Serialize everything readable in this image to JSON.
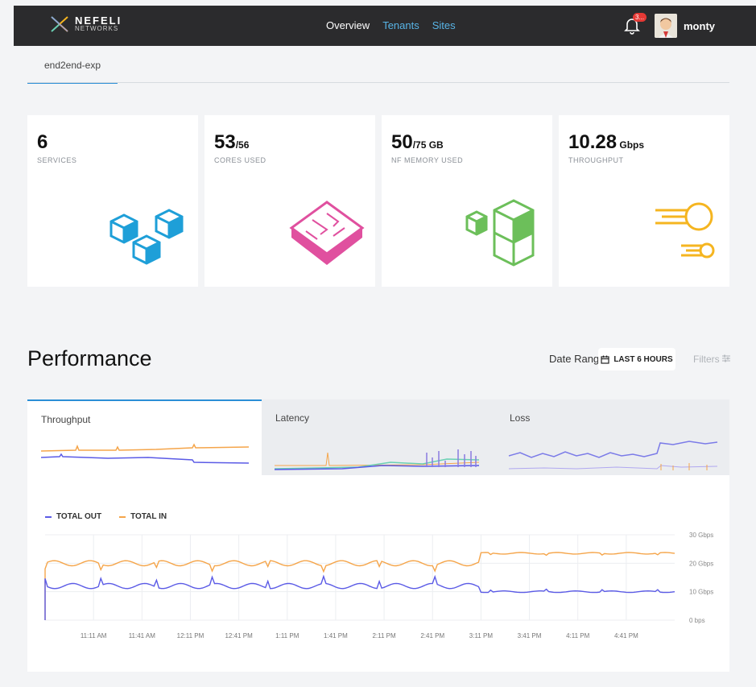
{
  "app": {
    "brand_line1": "NEFELI",
    "brand_line2": "NETWORKS"
  },
  "nav": {
    "items": [
      "Overview",
      "Tenants",
      "Sites"
    ],
    "active": "Overview"
  },
  "user": {
    "name": "monty",
    "notification_badge": "3..."
  },
  "subtab": {
    "label": "end2end-exp"
  },
  "stats": [
    {
      "value": "6",
      "unit": "",
      "label": "SERVICES",
      "icon": "cubes-icon",
      "color": "#1e9fd8"
    },
    {
      "value": "53",
      "unit": "/56",
      "label": "CORES USED",
      "icon": "chip-icon",
      "color": "#e0509f"
    },
    {
      "value": "50",
      "unit": "/75 GB",
      "label": "NF MEMORY USED",
      "icon": "memory-cubes-icon",
      "color": "#6cbf5a"
    },
    {
      "value": "10.28",
      "unit": " Gbps",
      "label": "THROUGHPUT",
      "icon": "throughput-icon",
      "color": "#f5b520"
    }
  ],
  "performance": {
    "title": "Performance",
    "date_range_label": "Date Range",
    "range_button": "LAST 6 HOURS",
    "filters_label": "Filters",
    "tabs": [
      "Throughput",
      "Latency",
      "Loss"
    ],
    "active_tab": "Throughput"
  },
  "chart_data": {
    "type": "line",
    "legend": [
      "TOTAL OUT",
      "TOTAL IN"
    ],
    "y_ticks": [
      "30 Gbps",
      "20 Gbps",
      "10 Gbps",
      "0 bps"
    ],
    "ylim": [
      0,
      30
    ],
    "x_ticks": [
      "11:11 AM",
      "11:41 AM",
      "12:11 PM",
      "12:41 PM",
      "1:11 PM",
      "1:41 PM",
      "2:11 PM",
      "2:41 PM",
      "3:11 PM",
      "3:41 PM",
      "4:11 PM",
      "4:41 PM"
    ],
    "x": [
      "10:41 AM",
      "11:11 AM",
      "11:41 AM",
      "12:11 PM",
      "12:41 PM",
      "1:11 PM",
      "1:41 PM",
      "2:11 PM",
      "2:41 PM",
      "2:56 PM",
      "3:11 PM",
      "3:41 PM",
      "4:11 PM",
      "4:41 PM"
    ],
    "series": [
      {
        "name": "TOTAL IN",
        "color": "#f5a54a",
        "values": [
          20,
          20,
          20,
          20,
          20,
          20,
          20,
          20,
          20,
          23.5,
          23.5,
          23.5,
          23.5,
          23.5
        ]
      },
      {
        "name": "TOTAL OUT",
        "color": "#5b5be6",
        "values": [
          12,
          12,
          12,
          12,
          12,
          12,
          12,
          12,
          12,
          10,
          10,
          10,
          10,
          10
        ]
      }
    ],
    "grid": true,
    "legend_position": "top-left"
  },
  "colors": {
    "accent": "#2b8fd6",
    "topbar": "#2b2b2d"
  }
}
